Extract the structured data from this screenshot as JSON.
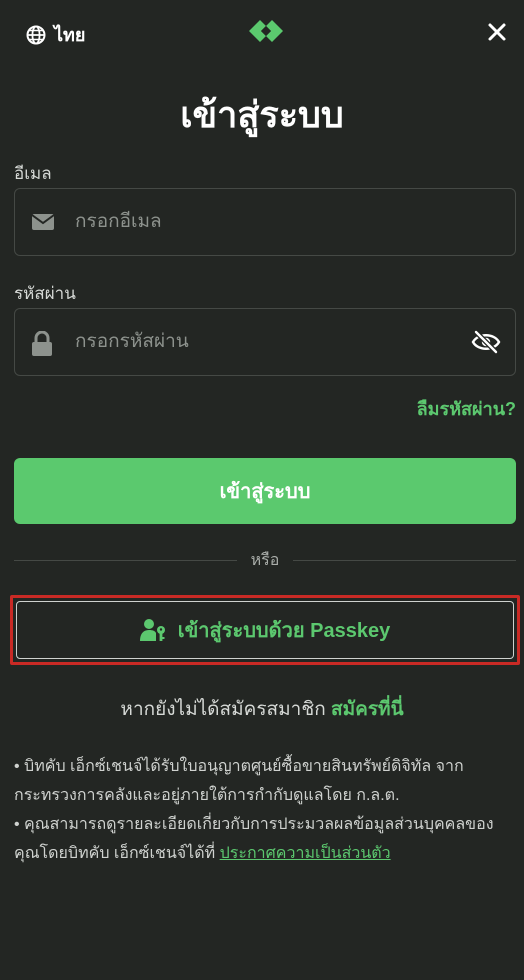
{
  "header": {
    "language_label": "ไทย",
    "globe_icon": "globe-icon",
    "logo_icon": "bitkub-logo-icon",
    "close_icon": "close-icon"
  },
  "page_title": "เข้าสู่ระบบ",
  "email": {
    "label": "อีเมล",
    "placeholder": "กรอกอีเมล",
    "value": "",
    "icon": "envelope-icon"
  },
  "password": {
    "label": "รหัสผ่าน",
    "placeholder": "กรอกรหัสผ่าน",
    "value": "",
    "icon": "lock-icon",
    "toggle_icon": "eye-slash-icon"
  },
  "forgot_password": "ลืมรหัสผ่าน?",
  "login_button": "เข้าสู่ระบบ",
  "divider_text": "หรือ",
  "passkey_button": {
    "label": "เข้าสู่ระบบด้วย Passkey",
    "icon": "user-key-icon"
  },
  "signup": {
    "prompt": "หากยังไม่ได้สมัครสมาชิก",
    "link": "สมัครที่นี่"
  },
  "notes": {
    "line1": "• บิทคับ เอ็กซ์เชนจ์ได้รับใบอนุญาตศูนย์ซื้อขายสินทรัพย์ดิจิทัล จากกระทรวงการคลังและอยู่ภายใต้การกำกับดูแลโดย ก.ล.ต.",
    "line2_prefix": "• คุณสามารถดูรายละเอียดเกี่ยวกับการประมวลผลข้อมูลส่วนบุคคลของคุณโดยบิทคับ เอ็กซ์เชนจ์ได้ที่ ",
    "policy_link": "ประกาศความเป็นส่วนตัว"
  },
  "colors": {
    "background": "#232623",
    "accent_green": "#5bc96e",
    "highlight_red": "#c92a25"
  }
}
